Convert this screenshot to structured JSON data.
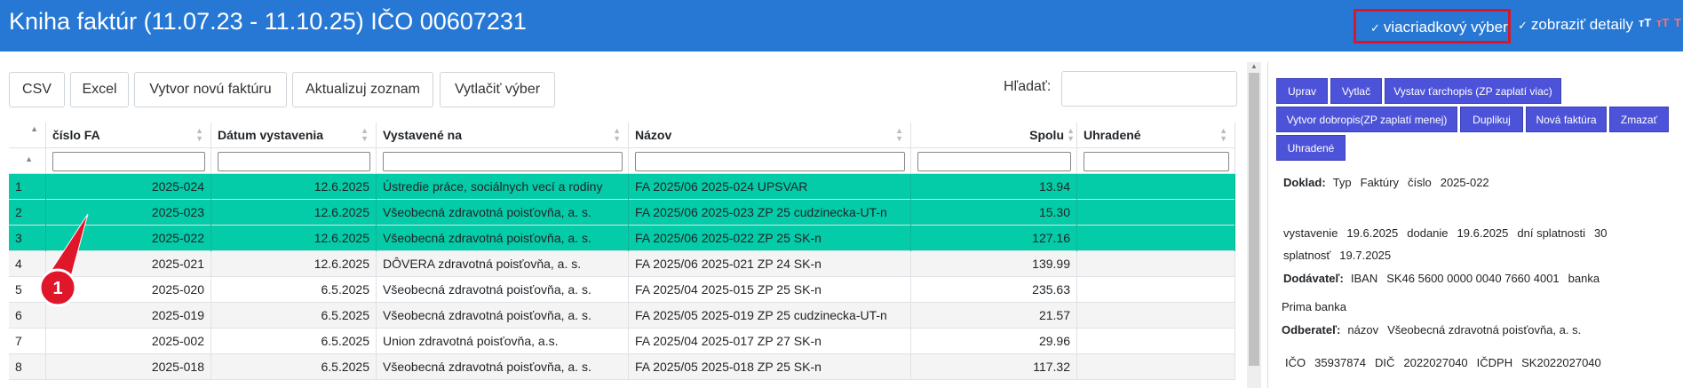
{
  "header": {
    "title": "Kniha faktúr (11.07.23 - 11.10.25) IČO 00607231",
    "opt_multiselect": "viacriadkový výber",
    "opt_details": "zobraziť detaily",
    "check_glyph": "✓",
    "font_buttons": [
      "ᴛT",
      "ᴛT",
      "T"
    ]
  },
  "toolbar": {
    "csv": "CSV",
    "excel": "Excel",
    "new_invoice": "Vytvor novú faktúru",
    "refresh": "Aktualizuj zoznam",
    "print_selection": "Vytlačiť výber",
    "search_label": "Hľadať:",
    "search_value": ""
  },
  "table": {
    "columns": [
      "",
      "číslo FA",
      "Dátum vystavenia",
      "Vystavené na",
      "Názov",
      "Spolu",
      "Uhradené"
    ],
    "rows": [
      {
        "n": "1",
        "num": "2025-024",
        "date": "12.6.2025",
        "to": "Ústredie práce, sociálnych vecí a rodiny",
        "name": "FA 2025/06 2025-024 UPSVAR",
        "total": "13.94",
        "paid": "",
        "selected": true
      },
      {
        "n": "2",
        "num": "2025-023",
        "date": "12.6.2025",
        "to": "Všeobecná zdravotná poisťovňa, a. s.",
        "name": "FA 2025/06 2025-023 ZP 25 cudzinecka-UT-n",
        "total": "15.30",
        "paid": "",
        "selected": true
      },
      {
        "n": "3",
        "num": "2025-022",
        "date": "12.6.2025",
        "to": "Všeobecná zdravotná poisťovňa, a. s.",
        "name": "FA 2025/06 2025-022 ZP 25 SK-n",
        "total": "127.16",
        "paid": "",
        "selected": true
      },
      {
        "n": "4",
        "num": "2025-021",
        "date": "12.6.2025",
        "to": "DÔVERA zdravotná poisťovňa, a. s.",
        "name": "FA 2025/06 2025-021 ZP 24 SK-n",
        "total": "139.99",
        "paid": "",
        "selected": false
      },
      {
        "n": "5",
        "num": "2025-020",
        "date": "6.5.2025",
        "to": "Všeobecná zdravotná poisťovňa, a. s.",
        "name": "FA 2025/04 2025-015 ZP 25 SK-n",
        "total": "235.63",
        "paid": "",
        "selected": false
      },
      {
        "n": "6",
        "num": "2025-019",
        "date": "6.5.2025",
        "to": "Všeobecná zdravotná poisťovňa, a. s.",
        "name": "FA 2025/05 2025-019 ZP 25 cudzinecka-UT-n",
        "total": "21.57",
        "paid": "",
        "selected": false
      },
      {
        "n": "7",
        "num": "2025-002",
        "date": "6.5.2025",
        "to": "Union zdravotná poisťovňa, a.s.",
        "name": "FA 2025/04 2025-017 ZP 27 SK-n",
        "total": "29.96",
        "paid": "",
        "selected": false
      },
      {
        "n": "8",
        "num": "2025-018",
        "date": "6.5.2025",
        "to": "Všeobecná zdravotná poisťovňa, a. s.",
        "name": "FA 2025/05 2025-018 ZP 25 SK-n",
        "total": "117.32",
        "paid": "",
        "selected": false
      }
    ]
  },
  "annotation": {
    "label": "1",
    "color": "#e0162b"
  },
  "panel": {
    "buttons": [
      "Uprav",
      "Vytlač",
      "Vystav ťarchopis (ZP zaplatí viac)",
      "Vytvor dobropis(ZP zaplatí menej)",
      "Duplikuj",
      "Nová faktúra",
      "Zmazať",
      "Uhradené"
    ],
    "doklad_label": "Doklad:",
    "doklad_typ_label": "Typ",
    "doklad_typ": "Faktúry",
    "doklad_cislo_label": "číslo",
    "doklad_cislo": "2025-022",
    "vystavenie_label": "vystavenie",
    "vystavenie": "19.6.2025",
    "dodanie_label": "dodanie",
    "dodanie": "19.6.2025",
    "dni_label": "dní splatnosti",
    "dni": "30",
    "splatnost_label": "splatnosť",
    "splatnost": "19.7.2025",
    "dodavatel_label": "Dodávateľ:",
    "iban_label": "IBAN",
    "iban": "SK46 5600 0000 0040 7660 4001",
    "banka_label": "banka",
    "banka": "Prima banka",
    "odberatel_label": "Odberateľ:",
    "nazov_label": "názov",
    "nazov": "Všeobecná zdravotná poisťovňa, a. s.",
    "ico_label": "IČO",
    "ico": "35937874",
    "dic_label": "DIČ",
    "dic": "2022027040",
    "icdph_label": "IČDPH",
    "icdph": "SK2022027040"
  },
  "colors": {
    "header": "#2778d5",
    "selected_row": "#04cca8",
    "panel_button": "#4d53d8",
    "highlight_box": "#d6182c"
  }
}
